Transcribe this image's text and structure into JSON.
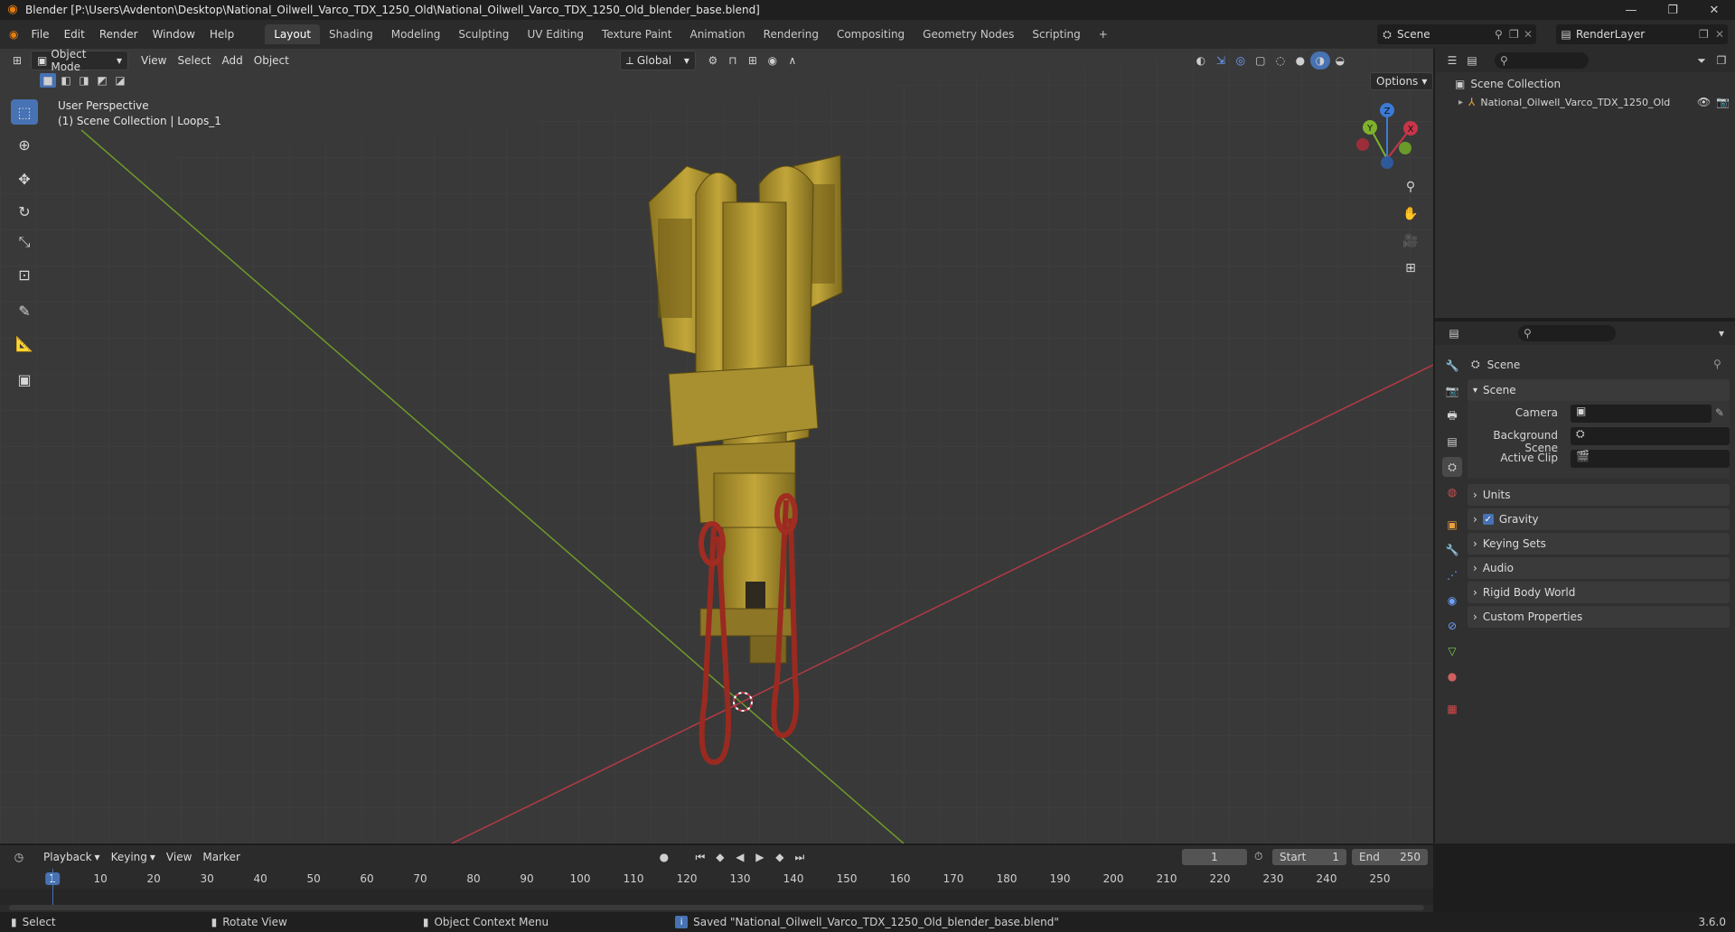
{
  "window": {
    "title": "Blender [P:\\Users\\Avdenton\\Desktop\\National_Oilwell_Varco_TDX_1250_Old\\National_Oilwell_Varco_TDX_1250_Old_blender_base.blend]",
    "minimize": "—",
    "maximize": "❐",
    "close": "✕"
  },
  "menus": [
    "File",
    "Edit",
    "Render",
    "Window",
    "Help"
  ],
  "workspaces": [
    "Layout",
    "Shading",
    "Modeling",
    "Sculpting",
    "UV Editing",
    "Texture Paint",
    "Animation",
    "Rendering",
    "Compositing",
    "Geometry Nodes",
    "Scripting"
  ],
  "add_workspace": "+",
  "scene_selector": "Scene",
  "renderlayer_selector": "RenderLayer",
  "viewport": {
    "mode": "Object Mode",
    "menus": [
      "View",
      "Select",
      "Add",
      "Object"
    ],
    "orientation": "Global",
    "options": "Options",
    "perspective": "User Perspective",
    "collection_info": "(1) Scene Collection | Loops_1",
    "gizmo": {
      "x": "X",
      "y": "Y",
      "z": "Z"
    }
  },
  "outliner": {
    "root": "Scene Collection",
    "items": [
      {
        "name": "National_Oilwell_Varco_TDX_1250_Old"
      }
    ]
  },
  "properties": {
    "header": "Scene",
    "section": "Scene",
    "fields": [
      {
        "label": "Camera"
      },
      {
        "label": "Background Scene"
      },
      {
        "label": "Active Clip"
      }
    ],
    "panels": [
      "Units",
      "Gravity",
      "Keying Sets",
      "Audio",
      "Rigid Body World",
      "Custom Properties"
    ]
  },
  "timeline": {
    "menus": [
      "Playback",
      "Keying",
      "View",
      "Marker"
    ],
    "current_frame": "1",
    "start_label": "Start",
    "start": "1",
    "end_label": "End",
    "end": "250",
    "ruler": [
      "1",
      "10",
      "20",
      "30",
      "40",
      "50",
      "60",
      "70",
      "80",
      "90",
      "100",
      "110",
      "120",
      "130",
      "140",
      "150",
      "160",
      "170",
      "180",
      "190",
      "200",
      "210",
      "220",
      "230",
      "240",
      "250"
    ]
  },
  "statusbar": {
    "select": "Select",
    "rotate": "Rotate View",
    "context": "Object Context Menu",
    "message": "Saved \"National_Oilwell_Varco_TDX_1250_Old_blender_base.blend\"",
    "version": "3.6.0"
  },
  "colors": {
    "accent": "#4772b3",
    "x_axis": "#c8354a",
    "y_axis": "#7fb22c",
    "z_axis": "#3b7ad6",
    "model": "#b59a2d",
    "loops": "#9a2a20"
  }
}
